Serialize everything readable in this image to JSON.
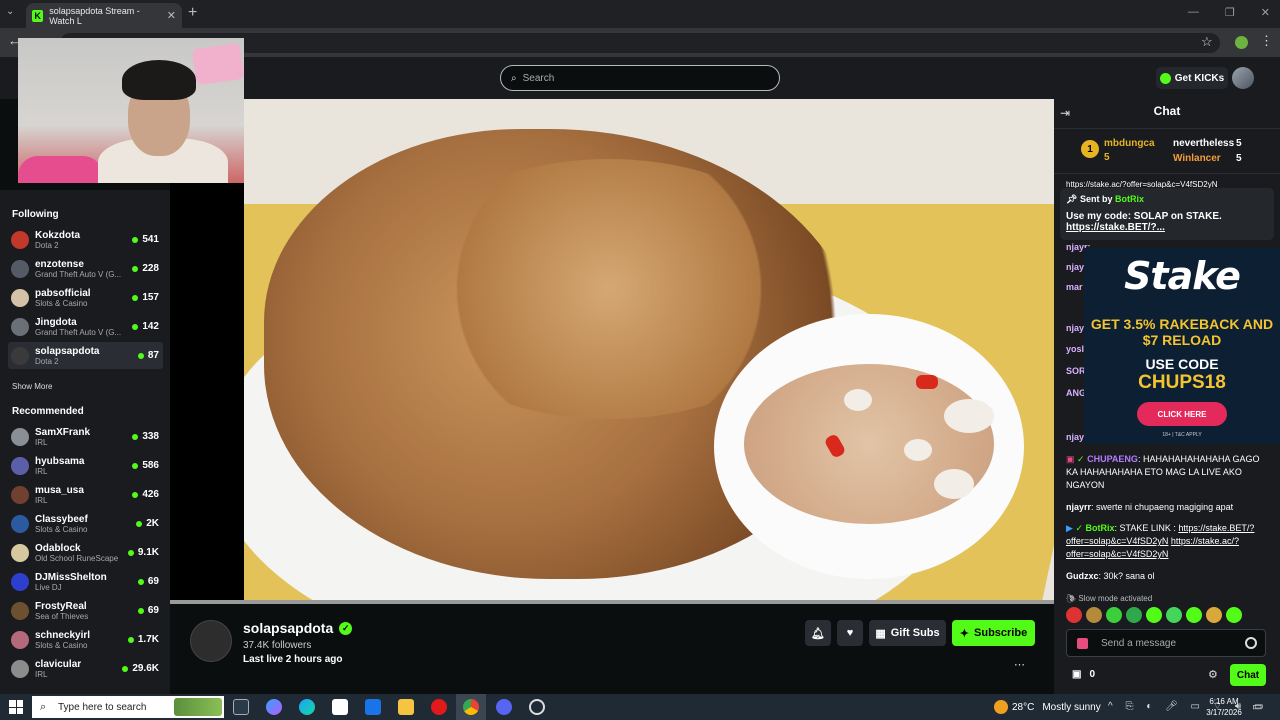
{
  "browser": {
    "tab_title": "solapsapdota Stream - Watch L",
    "tab_close": "✕",
    "new_tab": "+",
    "favicon_letter": "K"
  },
  "header": {
    "search_placeholder": "Search",
    "get_kicks": "Get KICKs"
  },
  "sidebar": {
    "following_title": "Following",
    "following": [
      {
        "name": "Kokzdota",
        "category": "Dota 2",
        "viewers": "541",
        "color": "#c0392b"
      },
      {
        "name": "enzotense",
        "category": "Grand Theft Auto V (G...",
        "viewers": "228",
        "color": "#555b66"
      },
      {
        "name": "pabsofficial",
        "category": "Slots & Casino",
        "viewers": "157",
        "color": "#d4c2a8"
      },
      {
        "name": "Jingdota",
        "category": "Grand Theft Auto V (G...",
        "viewers": "142",
        "color": "#6b6f76"
      },
      {
        "name": "solapsapdota",
        "category": "Dota 2",
        "viewers": "87",
        "color": "#3a3a3a"
      }
    ],
    "show_more": "Show More",
    "recommended_title": "Recommended",
    "recommended": [
      {
        "name": "SamXFrank",
        "category": "IRL",
        "viewers": "338",
        "color": "#8a8f96"
      },
      {
        "name": "hyubsama",
        "category": "IRL",
        "viewers": "586",
        "color": "#5b5fa8"
      },
      {
        "name": "musa_usa",
        "category": "IRL",
        "viewers": "426",
        "color": "#704030"
      },
      {
        "name": "Classybeef",
        "category": "Slots & Casino",
        "viewers": "2K",
        "color": "#2c5aa0"
      },
      {
        "name": "Odablock",
        "category": "Old School RuneScape",
        "viewers": "9.1K",
        "color": "#d6c9a0"
      },
      {
        "name": "DJMissShelton",
        "category": "Live DJ",
        "viewers": "69",
        "color": "#2d3fcf"
      },
      {
        "name": "FrostyReal",
        "category": "Sea of Thieves",
        "viewers": "69",
        "color": "#6d5030"
      },
      {
        "name": "schneckyirl",
        "category": "Slots & Casino",
        "viewers": "1.7K",
        "color": "#b46a7a"
      },
      {
        "name": "clavicular",
        "category": "IRL",
        "viewers": "29.6K",
        "color": "#8c8c8c"
      }
    ]
  },
  "stream": {
    "name": "solapsapdota",
    "followers": "37.4K followers",
    "last_live": "Last live 2 hours ago",
    "gift_subs": "Gift Subs",
    "subscribe": "Subscribe"
  },
  "chat": {
    "title": "Chat",
    "leaderboard": [
      {
        "rank": "1",
        "name": "mbdungca",
        "count": "5"
      },
      {
        "name": "nevertheless",
        "count": "5"
      },
      {
        "name": "Winlancer",
        "count": "5"
      }
    ],
    "hidden_link": "https://stake.ac/?offer=solap&c=V4fSD2yN",
    "pinned": {
      "sent_by": "Sent by",
      "bot": "BotRix",
      "message": "Use my code: SOLAP on STAKE.",
      "link": "https://stake.BET/?..."
    },
    "stubs": [
      "njayr: ",
      "njay",
      "mar",
      "",
      "njay",
      "yosl",
      "SOR",
      "ANG",
      "njay"
    ],
    "messages": [
      {
        "user": "CHUPAENG",
        "text": ": HAHAHAHAHAHAHA GAGO KA HAHAHAHAHA ETO MAG LA LIVE AKO NGAYON",
        "color": "#b57bff"
      },
      {
        "user": "njayrr",
        "text": ": swerte ni chupaeng magiging apat",
        "color": "#ffffff"
      },
      {
        "user": "BotRix",
        "text": ": STAKE LINK :",
        "link1": "https://stake.BET/?offer=solap&c=V4fSD2yN",
        "link2": "https://stake.ac/?offer=solap&c=V4fSD2yN",
        "color": "#53fc18"
      },
      {
        "user": "Gudzxc",
        "text": ": 30k? sana ol",
        "color": "#ffffff"
      }
    ],
    "slow_mode": "Slow mode activated",
    "input_placeholder": "Send a message",
    "kicks": "0",
    "send": "Chat"
  },
  "ad": {
    "brand": "Stake",
    "line1": "GET 3.5% RAKEBACK AND $7 RELOAD",
    "line2": "USE CODE",
    "code": "CHUPS18",
    "cta": "CLICK HERE",
    "tc": "18+ | T&C APPLY"
  },
  "taskbar": {
    "search": "Type here to search",
    "temp": "28°C",
    "weather": "Mostly sunny",
    "time": "6:16 AM",
    "date": "3/17/2026"
  }
}
